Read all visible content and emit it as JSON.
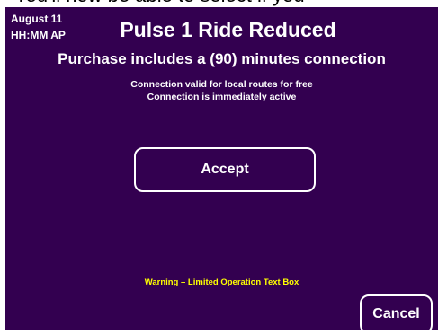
{
  "window": {
    "header_text": "You'll now be able to select if you"
  },
  "header": {
    "date": "August 11",
    "time": "HH:MM AP",
    "title": "Pulse 1 Ride Reduced",
    "subtitle": "Purchase includes a (90) minutes connection"
  },
  "info": {
    "line1": "Connection valid for local routes for free",
    "line2": "Connection is immediately active"
  },
  "actions": {
    "accept_label": "Accept",
    "cancel_label": "Cancel"
  },
  "warning": "Warning – Limited Operation Text Box",
  "colors": {
    "background": "#330050",
    "text": "#ffffff",
    "warning": "#ffff00"
  }
}
